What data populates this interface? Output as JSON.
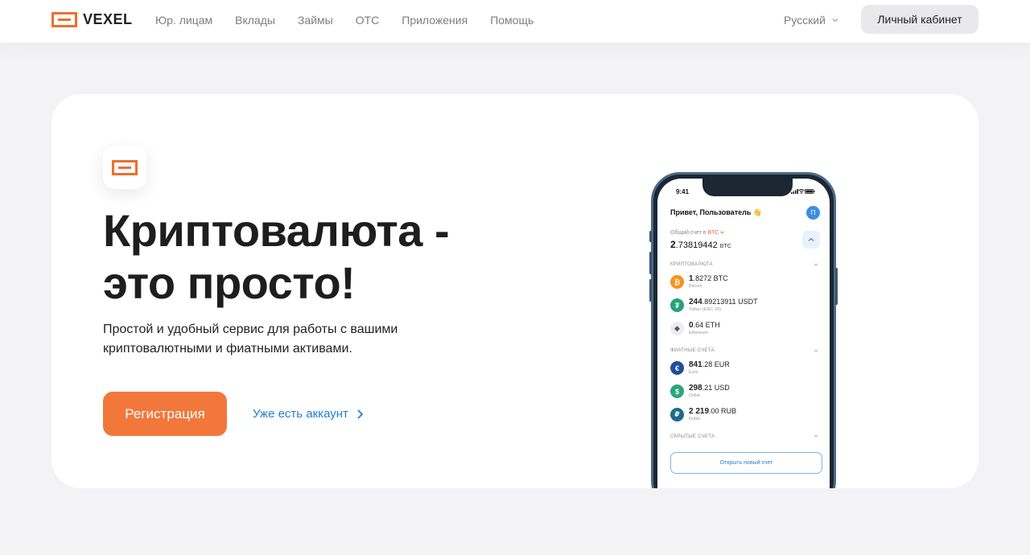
{
  "header": {
    "brand": "VEXEL",
    "nav": [
      {
        "label": "Юр. лицам"
      },
      {
        "label": "Вклады"
      },
      {
        "label": "Займы"
      },
      {
        "label": "OTC"
      },
      {
        "label": "Приложения"
      },
      {
        "label": "Помощь"
      }
    ],
    "language": "Русский",
    "cabinet_label": "Личный кабинет"
  },
  "hero": {
    "title": "Криптовалюта - это просто!",
    "subtitle": "Простой и удобный сервис для работы с вашими криптовалютными и фиатными активами.",
    "register_label": "Регистрация",
    "login_label": "Уже есть аккаунт"
  },
  "phone": {
    "time": "9:41",
    "greeting": "Привет, Пользователь 👋",
    "avatar_letter": "П",
    "total_label": "Общий счет в",
    "total_currency": "BTC",
    "total_int": "2",
    "total_frac": ".73819442",
    "total_unit": "BTC",
    "crypto_section": "КРИПТОВАЛЮТА",
    "fiat_section": "ФИАТНЫЕ СЧЕТА",
    "hidden_section": "СКРЫТЫЕ СЧЕТА",
    "crypto": [
      {
        "int": "1",
        "frac": ".8272 BTC",
        "name": "Bitcoin",
        "symbol": "₿",
        "color": "#f7931a"
      },
      {
        "int": "244",
        "frac": ".89213911 USDT",
        "name": "Tether (ERC-20)",
        "symbol": "₮",
        "color": "#26a17b"
      },
      {
        "int": "0",
        "frac": ".64 ETH",
        "name": "Ethereum",
        "symbol": "◆",
        "color": "#ececf0"
      }
    ],
    "fiat": [
      {
        "int": "841",
        "frac": ".28 EUR",
        "name": "Euro",
        "symbol": "€",
        "color": "#1f4f9a"
      },
      {
        "int": "298",
        "frac": ".21 USD",
        "name": "Dollar",
        "symbol": "$",
        "color": "#2aa77a"
      },
      {
        "int": "2 219",
        "frac": ".00 RUB",
        "name": "Ruble",
        "symbol": "₽",
        "color": "#1d6b8a"
      }
    ],
    "open_account_label": "Открыть новый счет"
  }
}
